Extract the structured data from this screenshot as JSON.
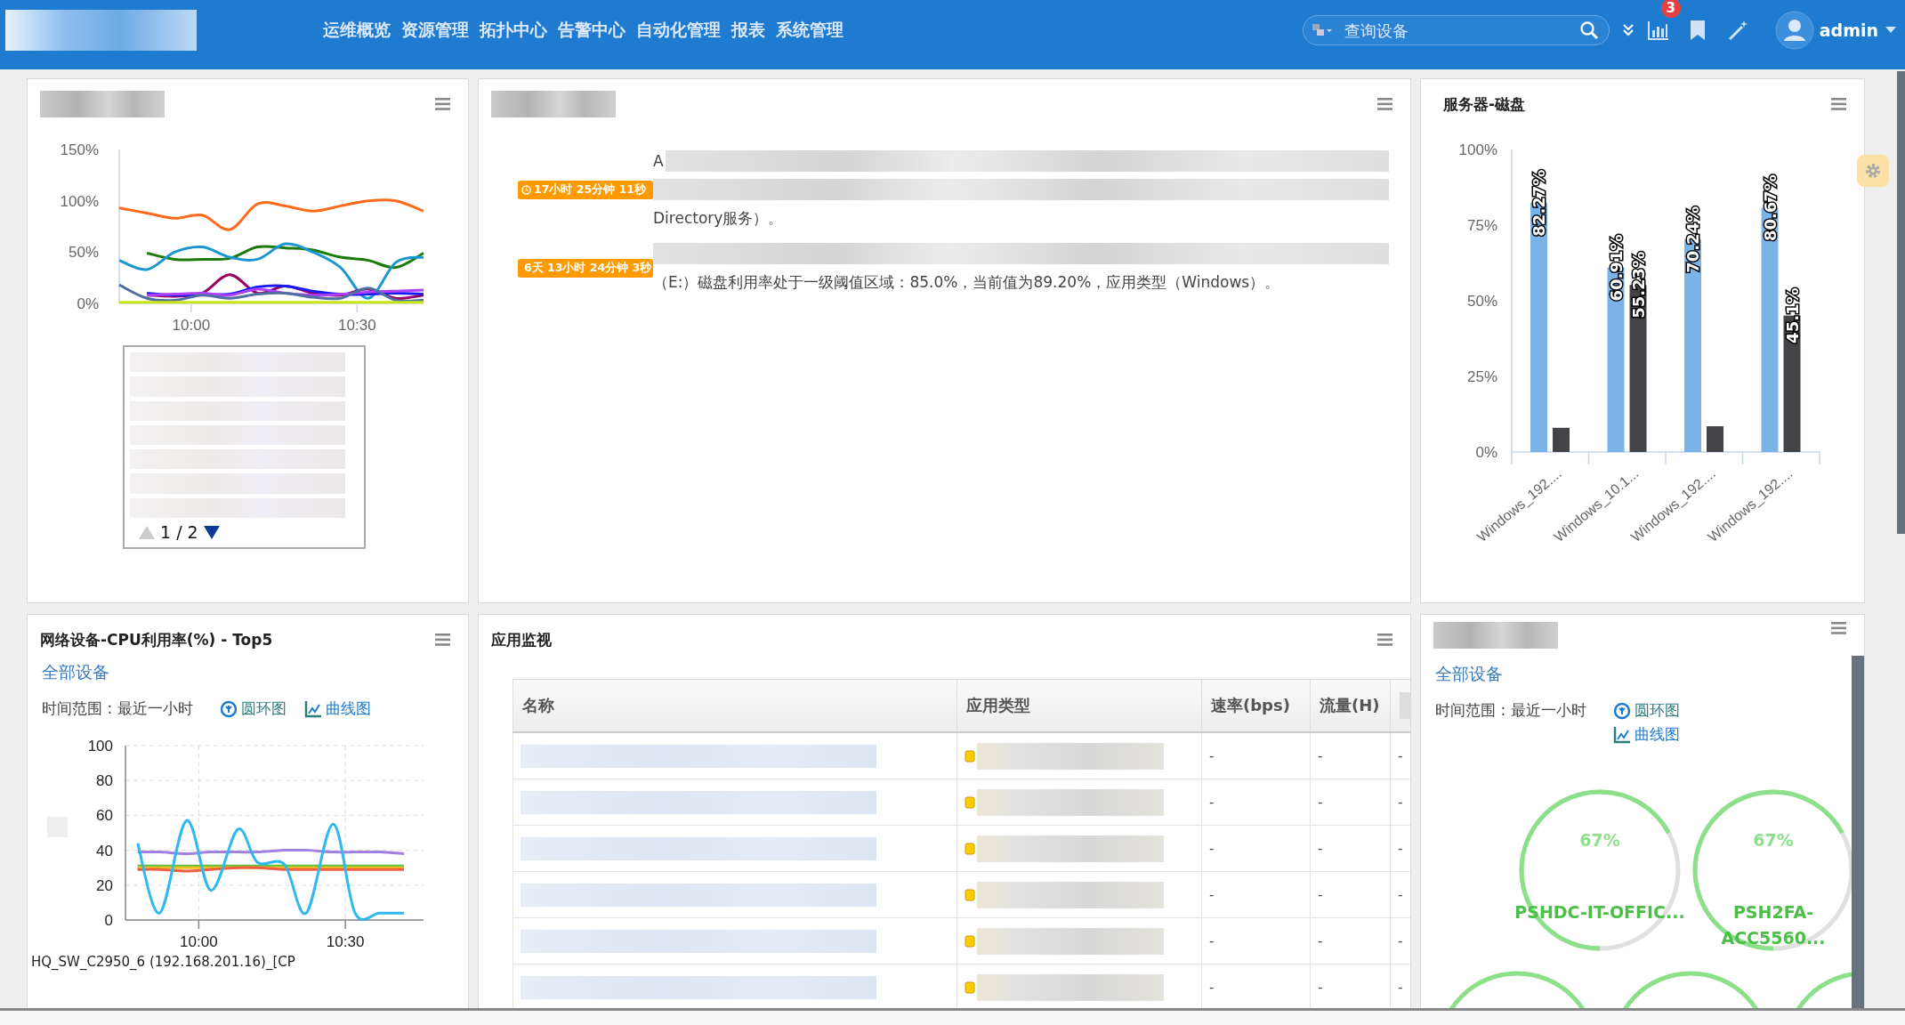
{
  "header": {
    "logo": {
      "kind": "redacted"
    },
    "nav": [
      {
        "label": "运维概览"
      },
      {
        "label": "资源管理"
      },
      {
        "label": "拓扑中心"
      },
      {
        "label": "告警中心"
      },
      {
        "label": "自动化管理"
      },
      {
        "label": "报表"
      },
      {
        "label": "系统管理"
      }
    ],
    "search": {
      "placeholder": "查询设备"
    },
    "alert_count": "3",
    "user": "admin"
  },
  "top_left_panel": {
    "title": {
      "kind": "redacted"
    },
    "chart_data": {
      "type": "line",
      "x": [
        587,
        592,
        597,
        602,
        607,
        612,
        617,
        622,
        627,
        632,
        637,
        642
      ],
      "xlim": [
        587,
        642
      ],
      "ylim": [
        0,
        150
      ],
      "xticks": [
        {
          "value": 600,
          "label": "10:00"
        },
        {
          "value": 630,
          "label": "10:30"
        }
      ],
      "yticks": [
        {
          "value": 0,
          "label": "0%"
        },
        {
          "value": 50,
          "label": "50%"
        },
        {
          "value": 100,
          "label": "100%"
        },
        {
          "value": 150,
          "label": "150%"
        }
      ],
      "series": [
        {
          "color": "#ff6a1a",
          "values": [
            93,
            88,
            83,
            86,
            72,
            97,
            95,
            90,
            95,
            100,
            100,
            90
          ]
        },
        {
          "color": "#1a7a0a",
          "values": [
            null,
            49,
            43,
            43,
            44,
            55,
            54,
            52,
            45,
            42,
            35,
            49
          ]
        },
        {
          "color": "#1a96d0",
          "values": [
            42,
            33,
            50,
            55,
            45,
            43,
            58,
            50,
            35,
            5,
            40,
            45
          ]
        },
        {
          "color": "#990066",
          "values": [
            null,
            8,
            7,
            10,
            28,
            10,
            17,
            10,
            8,
            14,
            5,
            8
          ]
        },
        {
          "color": "#1a1aff",
          "values": [
            null,
            10,
            8,
            9,
            9,
            16,
            17,
            12,
            9,
            9,
            10,
            9
          ]
        },
        {
          "color": "#b040ff",
          "values": [
            null,
            8,
            9,
            10,
            8,
            14,
            10,
            8,
            9,
            11,
            12,
            13
          ]
        },
        {
          "color": "#4e6fa0",
          "values": [
            18,
            5,
            3,
            8,
            5,
            9,
            10,
            6,
            5,
            15,
            3,
            3
          ]
        },
        {
          "color": "#c8e614",
          "values": [
            1,
            1,
            1,
            1,
            1,
            1,
            1,
            1,
            1,
            1,
            1,
            1
          ]
        }
      ]
    },
    "legend": {
      "rows": [
        {
          "kind": "redacted"
        },
        {
          "kind": "redacted"
        },
        {
          "kind": "redacted"
        },
        {
          "kind": "redacted"
        },
        {
          "kind": "redacted"
        },
        {
          "kind": "redacted"
        },
        {
          "kind": "redacted"
        }
      ],
      "page": "1 / 2",
      "prev": {
        "disabled": true
      },
      "next": {
        "disabled": false
      }
    }
  },
  "alerts_panel": {
    "title": {
      "kind": "redacted"
    },
    "alerts": [
      {
        "duration": "17小时 25分钟 11秒",
        "lines": [
          [
            {
              "kind": "text",
              "text": "A"
            },
            {
              "kind": "redacted"
            }
          ],
          [
            {
              "kind": "redacted"
            }
          ],
          [
            {
              "kind": "text",
              "text": "Directory服务）。"
            }
          ]
        ]
      },
      {
        "duration": "6天 13小时 24分钟 3秒",
        "lines": [
          [
            {
              "kind": "redacted"
            }
          ],
          [
            {
              "kind": "text",
              "text": "（E:）磁盘利用率处于一级阈值区域：85.0%，当前值为89.20%，应用类型（Windows）。"
            }
          ]
        ]
      }
    ]
  },
  "disk_panel": {
    "title": {
      "kind": "text",
      "text": "服务器-磁盘"
    },
    "chart_data": {
      "type": "bar",
      "categories": [
        "Windows_192....",
        "Windows_10.1...",
        "Windows_192....",
        "Windows_192...."
      ],
      "ylim": [
        0,
        100
      ],
      "yticks": [
        {
          "value": 0,
          "label": "0%"
        },
        {
          "value": 25,
          "label": "25%"
        },
        {
          "value": 50,
          "label": "50%"
        },
        {
          "value": 75,
          "label": "75%"
        },
        {
          "value": 100,
          "label": "100%"
        }
      ],
      "series": [
        {
          "color": "#7ab3e8",
          "values": [
            82.3,
            60.9,
            70.2,
            80.7
          ]
        },
        {
          "color": "#434348",
          "values": [
            8,
            55.2,
            8.5,
            45.1
          ]
        }
      ],
      "value_labels": [
        [
          "82.27%",
          "60.91%",
          "70.24%",
          "80.67%"
        ],
        [
          null,
          "55.23%",
          null,
          "45.1%"
        ]
      ]
    }
  },
  "cpu_panel": {
    "title": {
      "kind": "text",
      "text": "网络设备-CPU利用率(%) - Top5"
    },
    "link": "全部设备",
    "range": "时间范围 : 最近一小时",
    "views": [
      {
        "kind": "ring",
        "label": "圆环图"
      },
      {
        "kind": "line",
        "label": "曲线图"
      }
    ],
    "chart_data": {
      "type": "line",
      "x": [
        587.5,
        592,
        597.5,
        602.5,
        608,
        612,
        617.5,
        622,
        627.5,
        632,
        637,
        642
      ],
      "xlim": [
        585,
        646
      ],
      "ylim": [
        0,
        100
      ],
      "grid": true,
      "xticks": [
        {
          "value": 600,
          "label": "10:00"
        },
        {
          "value": 630,
          "label": "10:30"
        }
      ],
      "yticks": [
        0,
        20,
        40,
        60,
        80,
        100
      ],
      "series": [
        {
          "color": "#a080e0",
          "values": [
            39,
            39,
            38,
            39,
            39,
            39,
            40,
            40,
            39,
            39,
            39,
            38
          ]
        },
        {
          "color": "#60c040",
          "values": [
            31,
            31,
            31,
            31,
            31,
            31,
            31,
            31,
            31,
            31,
            31,
            31
          ]
        },
        {
          "color": "#f0c020",
          "values": [
            30,
            30,
            30,
            30,
            30,
            30,
            30,
            30,
            30,
            30,
            30,
            30
          ]
        },
        {
          "color": "#f06040",
          "values": [
            29,
            29,
            28,
            29,
            30,
            30,
            29,
            29,
            29,
            29,
            29,
            29
          ]
        },
        {
          "color": "#30b8f0",
          "values": [
            44,
            4,
            57,
            17,
            52,
            33,
            32,
            4,
            55,
            4,
            4,
            4
          ]
        }
      ]
    },
    "legend_text": "HQ_SW_C2950_6 (192.168.201.16)_[CP"
  },
  "app_panel": {
    "title": {
      "kind": "text",
      "text": "应用监视"
    },
    "columns": [
      {
        "kind": "text",
        "label": "名称"
      },
      {
        "kind": "text",
        "label": "应用类型"
      },
      {
        "kind": "text",
        "label": "速率(bps)"
      },
      {
        "kind": "text",
        "label": "流量(H)"
      },
      {
        "kind": "redacted"
      }
    ],
    "rows": [
      {
        "name": {
          "kind": "redacted"
        },
        "type": {
          "kind": "redacted"
        },
        "rate": "-",
        "flow": "-",
        "column_5": "-"
      },
      {
        "name": {
          "kind": "redacted"
        },
        "type": {
          "kind": "redacted"
        },
        "rate": "-",
        "flow": "-",
        "column_5": "-"
      },
      {
        "name": {
          "kind": "redacted"
        },
        "type": {
          "kind": "redacted"
        },
        "rate": "-",
        "flow": "-",
        "column_5": "-"
      },
      {
        "name": {
          "kind": "redacted"
        },
        "type": {
          "kind": "redacted"
        },
        "rate": "-",
        "flow": "-",
        "column_5": "-"
      },
      {
        "name": {
          "kind": "redacted"
        },
        "type": {
          "kind": "redacted"
        },
        "rate": "-",
        "flow": "-",
        "column_5": "-"
      },
      {
        "name": {
          "kind": "redacted"
        },
        "type": {
          "kind": "redacted"
        },
        "rate": "-",
        "flow": "-",
        "column_5": "-"
      }
    ]
  },
  "ring_panel": {
    "title": {
      "kind": "redacted"
    },
    "link": "全部设备",
    "range": "时间范围 : 最近一小时",
    "views": [
      {
        "kind": "ring",
        "label": "圆环图"
      },
      {
        "kind": "line",
        "label": "曲线图"
      }
    ],
    "gauges": [
      {
        "kind": "gauge",
        "value": "67%",
        "level": 0.67,
        "label_lines": [
          "PSHDC-IT-OFFIC..."
        ]
      },
      {
        "kind": "gauge",
        "value": "67%",
        "level": 0.67,
        "label_lines": [
          "PSH2FA-",
          "ACC5560..."
        ]
      }
    ],
    "more_rings": [
      {
        "kind": "ring"
      },
      {
        "kind": "ring"
      },
      {
        "kind": "ring"
      }
    ]
  }
}
